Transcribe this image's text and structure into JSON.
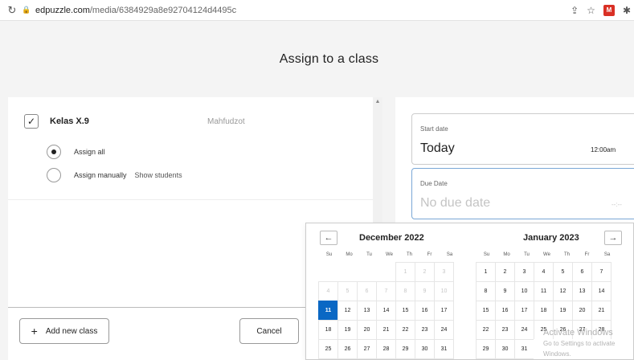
{
  "browser": {
    "reload_icon": "reload-icon",
    "lock_icon": "lock-icon",
    "url_host": "edpuzzle.com",
    "url_path": "/media/6384929a8e92704124d4495c",
    "share_icon": "share-icon",
    "star_icon": "star-icon"
  },
  "header": {
    "title": "Assign to a class"
  },
  "class_row": {
    "check": "✓",
    "name": "Kelas X.9",
    "teacher": "Mahfudzot"
  },
  "assign_options": [
    {
      "label": "Assign all",
      "selected": true
    },
    {
      "label": "Assign manually",
      "selected": false,
      "extra": "Show students"
    }
  ],
  "footer": {
    "add_label": "Add new class",
    "add_plus": "+",
    "cancel_label": "Cancel"
  },
  "start_date": {
    "label": "Start date",
    "value": "Today",
    "time": "12:00am"
  },
  "due_date": {
    "label": "Due Date",
    "placeholder": "No due date",
    "time": "--:--"
  },
  "calendar": {
    "prev_icon": "←",
    "next_icon": "→",
    "weekdays": [
      "Su",
      "Mo",
      "Tu",
      "We",
      "Th",
      "Fr",
      "Sa"
    ],
    "months": [
      {
        "title": "December 2022",
        "weeks": [
          [
            "",
            "",
            "",
            "",
            "1",
            "2",
            "3"
          ],
          [
            "4",
            "5",
            "6",
            "7",
            "8",
            "9",
            "10"
          ],
          [
            "11",
            "12",
            "13",
            "14",
            "15",
            "16",
            "17"
          ],
          [
            "18",
            "19",
            "20",
            "21",
            "22",
            "23",
            "24"
          ],
          [
            "25",
            "26",
            "27",
            "28",
            "29",
            "30",
            "31"
          ]
        ],
        "disabled_until": 10,
        "selected": 11
      },
      {
        "title": "January 2023",
        "weeks": [
          [
            "1",
            "2",
            "3",
            "4",
            "5",
            "6",
            "7"
          ],
          [
            "8",
            "9",
            "10",
            "11",
            "12",
            "13",
            "14"
          ],
          [
            "15",
            "16",
            "17",
            "18",
            "19",
            "20",
            "21"
          ],
          [
            "22",
            "23",
            "24",
            "25",
            "26",
            "27",
            "28"
          ],
          [
            "29",
            "30",
            "31",
            "",
            "",
            "",
            ""
          ]
        ]
      }
    ]
  },
  "watermark": {
    "line1": "Activate Windows",
    "line2": "Go to Settings to activate Windows."
  }
}
